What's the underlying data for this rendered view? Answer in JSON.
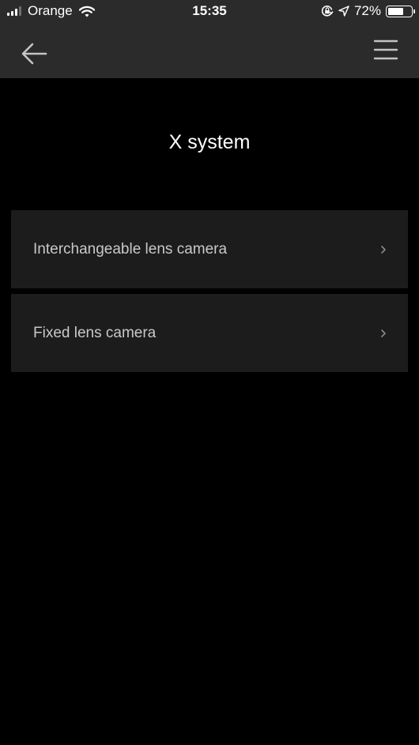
{
  "status_bar": {
    "carrier": "Orange",
    "time": "15:35",
    "battery_text": "72%",
    "battery_level": 0.72,
    "icons": [
      "signal-icon",
      "wifi-icon",
      "orientation-lock-icon",
      "location-icon",
      "battery-icon"
    ]
  },
  "header": {
    "back_icon": "arrow-left-icon",
    "menu_icon": "hamburger-menu-icon"
  },
  "page": {
    "title": "X system"
  },
  "menu": {
    "items": [
      {
        "label": "Interchangeable lens camera",
        "icon": "chevron-right-icon"
      },
      {
        "label": "Fixed lens camera",
        "icon": "chevron-right-icon"
      }
    ]
  },
  "colors": {
    "background": "#000000",
    "header_bar": "#2b2b2b",
    "list_item_bg": "#1c1c1c",
    "list_item_text": "#c9c9c9",
    "title_text": "#ffffff"
  }
}
